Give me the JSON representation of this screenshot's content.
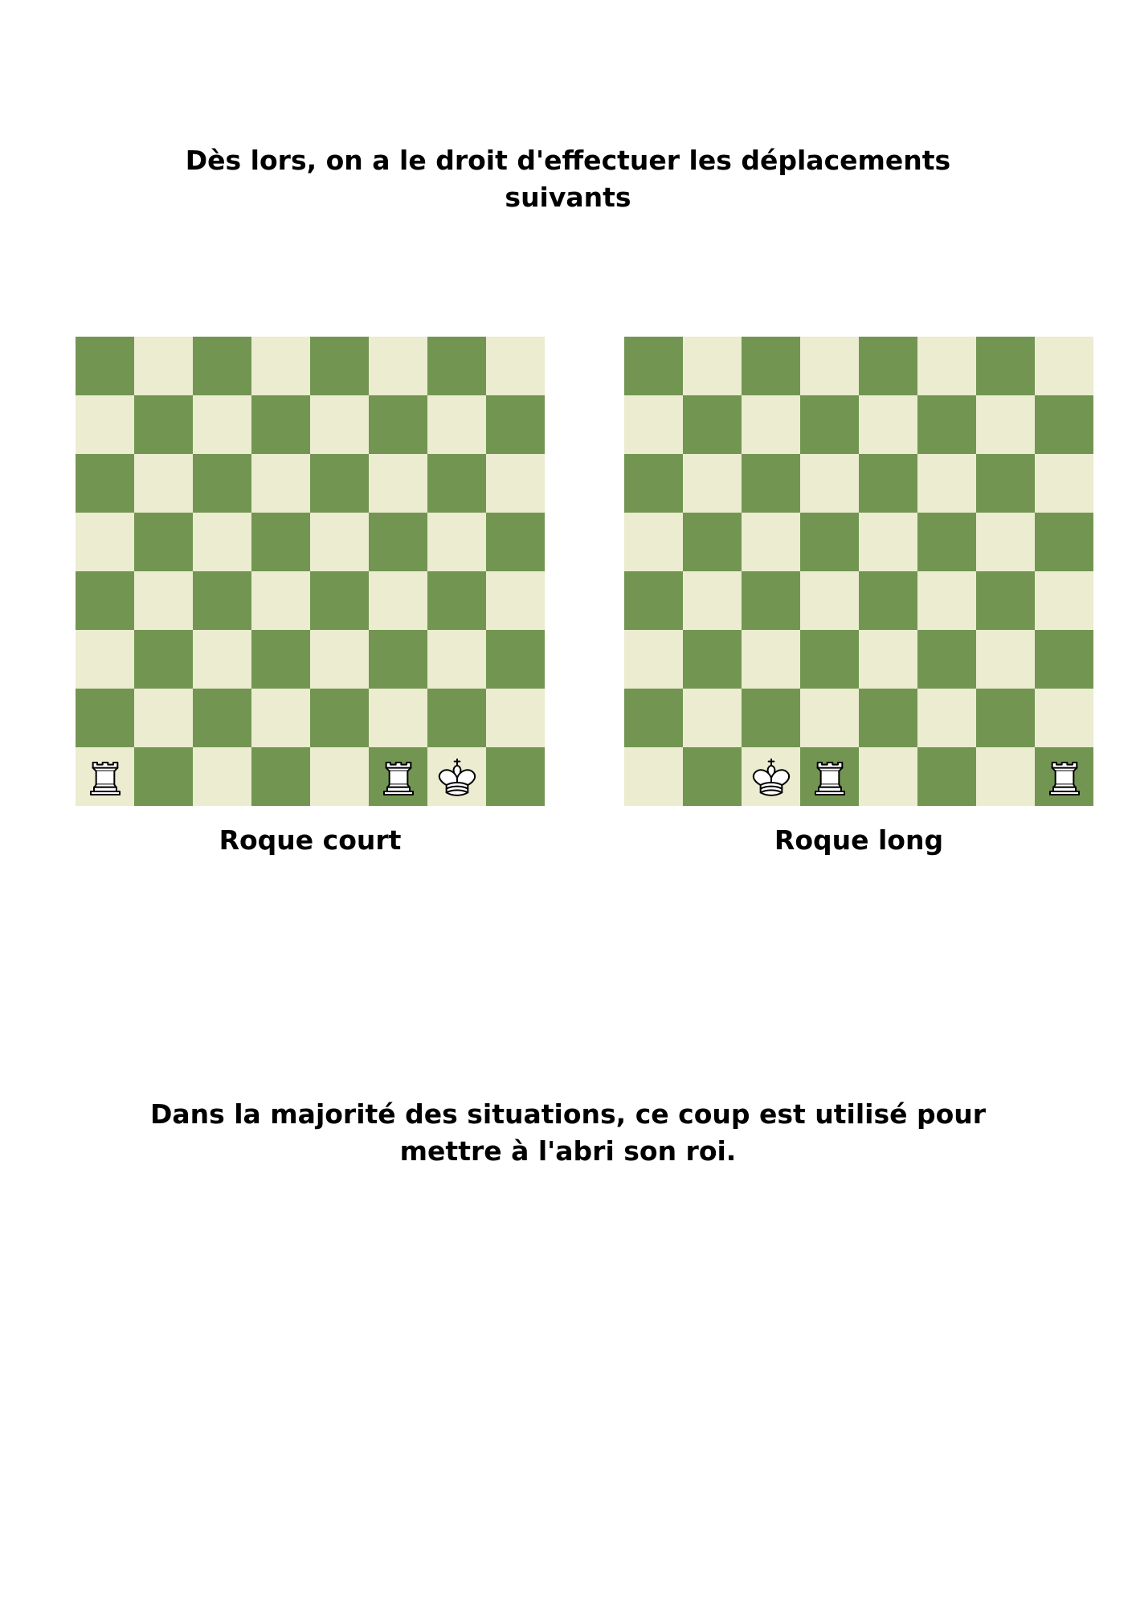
{
  "intro": {
    "line1": "Dès lors, on a le droit d'effectuer les déplacements",
    "line2": "suivants"
  },
  "colors": {
    "dark_square": "#739552",
    "light_square": "#ebecd0",
    "piece_fill": "#ffffff",
    "piece_outline": "#000000"
  },
  "boards": [
    {
      "caption": "Roque court",
      "pieces": [
        {
          "type": "rook",
          "color": "white",
          "square": "a1",
          "icon": "white-rook-icon"
        },
        {
          "type": "rook",
          "color": "white",
          "square": "f1",
          "icon": "white-rook-icon"
        },
        {
          "type": "king",
          "color": "white",
          "square": "g1",
          "icon": "white-king-icon"
        }
      ]
    },
    {
      "caption": "Roque long",
      "pieces": [
        {
          "type": "king",
          "color": "white",
          "square": "c1",
          "icon": "white-king-icon"
        },
        {
          "type": "rook",
          "color": "white",
          "square": "d1",
          "icon": "white-rook-icon"
        },
        {
          "type": "rook",
          "color": "white",
          "square": "h1",
          "icon": "white-rook-icon"
        }
      ]
    }
  ],
  "outro": {
    "line1": "Dans la majorité des situations, ce coup est utilisé pour",
    "line2": "mettre à l'abri son roi."
  }
}
